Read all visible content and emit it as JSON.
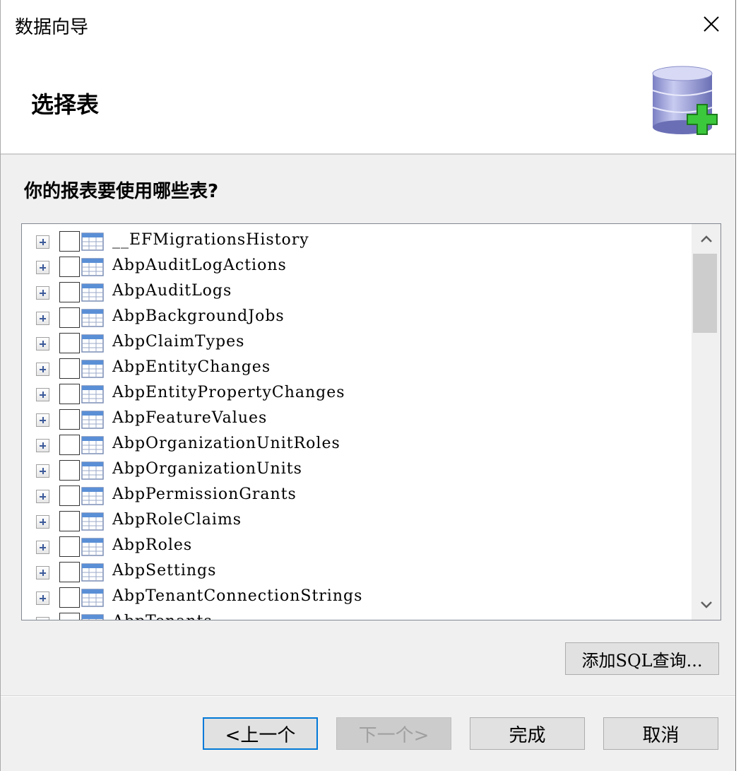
{
  "window": {
    "title": "数据向导"
  },
  "header": {
    "title": "选择表"
  },
  "prompt": "你的报表要使用哪些表?",
  "tables": [
    "__EFMigrationsHistory",
    "AbpAuditLogActions",
    "AbpAuditLogs",
    "AbpBackgroundJobs",
    "AbpClaimTypes",
    "AbpEntityChanges",
    "AbpEntityPropertyChanges",
    "AbpFeatureValues",
    "AbpOrganizationUnitRoles",
    "AbpOrganizationUnits",
    "AbpPermissionGrants",
    "AbpRoleClaims",
    "AbpRoles",
    "AbpSettings",
    "AbpTenantConnectionStrings",
    "AbpTenants"
  ],
  "buttons": {
    "add_sql": "添加SQL查询...",
    "prev": "<上一个",
    "next": "下一个>",
    "finish": "完成",
    "cancel": "取消"
  },
  "icons": {
    "close": "close-icon",
    "database_add": "database-add-icon",
    "table": "table-icon",
    "expander": "plus-expander-icon"
  },
  "colors": {
    "focus_border": "#0078d7",
    "db_body": "#9fa3d8",
    "plus_green": "#3cc83c"
  }
}
